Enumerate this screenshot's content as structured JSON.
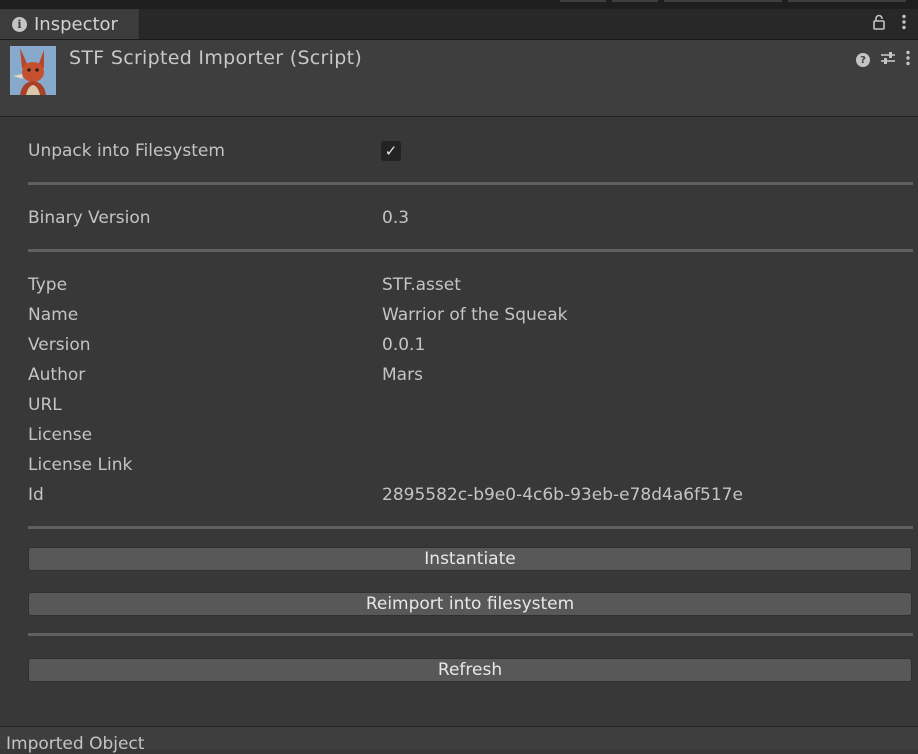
{
  "tab": {
    "label": "Inspector"
  },
  "header": {
    "title": "STF Scripted Importer (Script)"
  },
  "unpack": {
    "label": "Unpack into Filesystem",
    "checked": true
  },
  "binary": {
    "label": "Binary Version",
    "value": "0.3"
  },
  "fields": [
    {
      "label": "Type",
      "value": "STF.asset"
    },
    {
      "label": "Name",
      "value": "Warrior of the Squeak"
    },
    {
      "label": "Version",
      "value": "0.0.1"
    },
    {
      "label": "Author",
      "value": "Mars"
    },
    {
      "label": "URL",
      "value": ""
    },
    {
      "label": "License",
      "value": ""
    },
    {
      "label": "License Link",
      "value": ""
    },
    {
      "label": "Id",
      "value": "2895582c-b9e0-4c6b-93eb-e78d4a6f517e"
    }
  ],
  "buttons": {
    "instantiate": "Instantiate",
    "reimport": "Reimport into filesystem",
    "refresh": "Refresh"
  },
  "footer": {
    "label": "Imported Object"
  },
  "icons": {
    "info": "info-icon",
    "lock": "lock-icon",
    "kebab": "kebab-menu-icon",
    "help": "help-icon",
    "presets": "presets-icon",
    "check": "checkmark-icon"
  },
  "colors": {
    "background": "#383838",
    "header": "#3e3e3e",
    "button": "#585858",
    "divider": "#5f5f5f"
  }
}
